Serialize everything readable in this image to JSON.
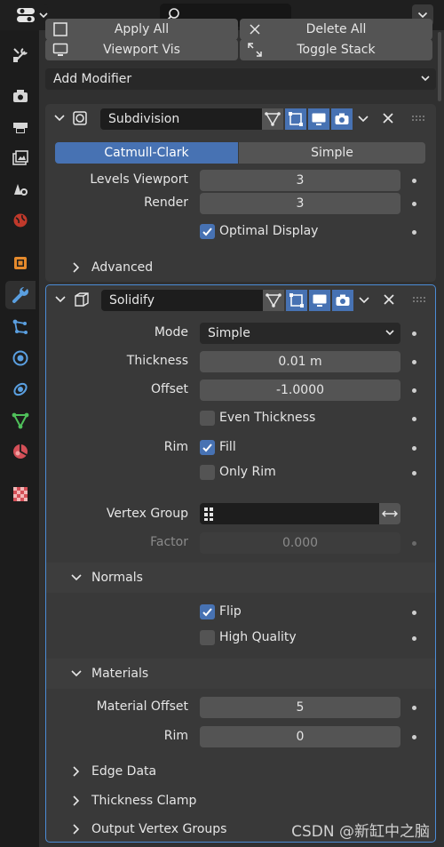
{
  "toolbar": {
    "apply_all": "Apply All",
    "delete_all": "Delete All",
    "viewport_vis": "Viewport Vis",
    "toggle_stack": "Toggle Stack",
    "add_modifier": "Add Modifier"
  },
  "sidebar": {
    "tabs": [
      "tool",
      "render",
      "output",
      "view-layer",
      "scene",
      "world",
      "object",
      "modifiers",
      "particles",
      "physics",
      "constraints",
      "data",
      "material",
      "texture"
    ],
    "active": "modifiers"
  },
  "subdivision": {
    "name": "Subdivision",
    "methods": [
      "Catmull-Clark",
      "Simple"
    ],
    "active_method": "Catmull-Clark",
    "levels_viewport_label": "Levels Viewport",
    "levels_viewport": "3",
    "render_label": "Render",
    "render": "3",
    "optimal_display_label": "Optimal Display",
    "optimal_display": true,
    "advanced_label": "Advanced"
  },
  "solidify": {
    "name": "Solidify",
    "mode_label": "Mode",
    "mode": "Simple",
    "thickness_label": "Thickness",
    "thickness": "0.01 m",
    "offset_label": "Offset",
    "offset": "-1.0000",
    "even_thickness_label": "Even Thickness",
    "even_thickness": false,
    "rim_label": "Rim",
    "rim_fill_label": "Fill",
    "rim_fill": true,
    "only_rim_label": "Only Rim",
    "only_rim": false,
    "vertex_group_label": "Vertex Group",
    "vertex_group": "",
    "factor_label": "Factor",
    "factor": "0.000",
    "normals_label": "Normals",
    "flip_label": "Flip",
    "flip": true,
    "high_quality_label": "High Quality",
    "high_quality": false,
    "materials_label": "Materials",
    "material_offset_label": "Material Offset",
    "material_offset": "5",
    "material_rim_label": "Rim",
    "material_rim": "0",
    "edge_data_label": "Edge Data",
    "thickness_clamp_label": "Thickness Clamp",
    "output_vertex_groups_label": "Output Vertex Groups"
  },
  "watermark": "CSDN @新缸中之脑",
  "colors": {
    "accent": "#4772b3",
    "selected_outline": "#4b8cd6",
    "panel": "#303030",
    "modifier_bg": "#393939",
    "field": "#545454"
  }
}
